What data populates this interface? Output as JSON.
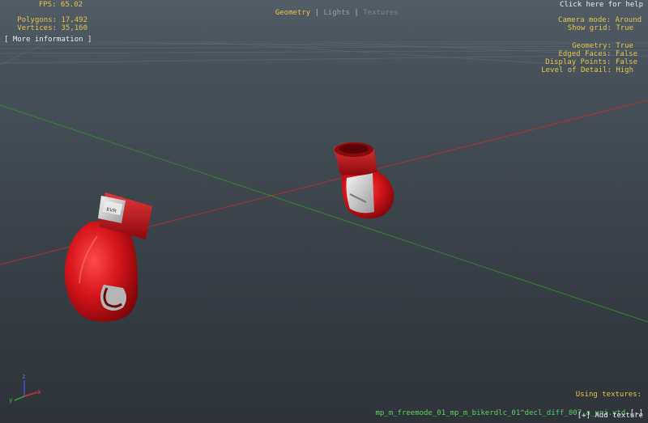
{
  "stats": {
    "fps": "FPS: 65.02",
    "polygons": "Polygons: 17,492",
    "vertices": "Vertices: 35,160",
    "more_info": "[ More information ]"
  },
  "tabs": {
    "items": [
      "Geometry",
      "Lights",
      "Textures"
    ]
  },
  "help": {
    "label": "Click here for help"
  },
  "camera": {
    "camera_mode": "Camera mode: Around",
    "show_grid": "Show grid: True"
  },
  "display": {
    "geometry": "Geometry: True",
    "edged_faces": "Edged Faces: False",
    "display_points": "Display Points: False",
    "level_of_detail": "Level of Detail: High"
  },
  "textures": {
    "heading": "Using textures:",
    "file": "mp_m_freemode_01_mp_m_bikerdlc_01^decl_diff_007_a_uni.ytd",
    "remove": "[-]",
    "add": "[+] Add texture"
  },
  "axes": {
    "x": "x",
    "y": "y",
    "z": "z"
  },
  "colors": {
    "accent_text": "#e6c24a",
    "texture_text": "#58d060",
    "glove_red": "#c8121a",
    "axis_x": "#d03030",
    "axis_z": "#30a030"
  }
}
